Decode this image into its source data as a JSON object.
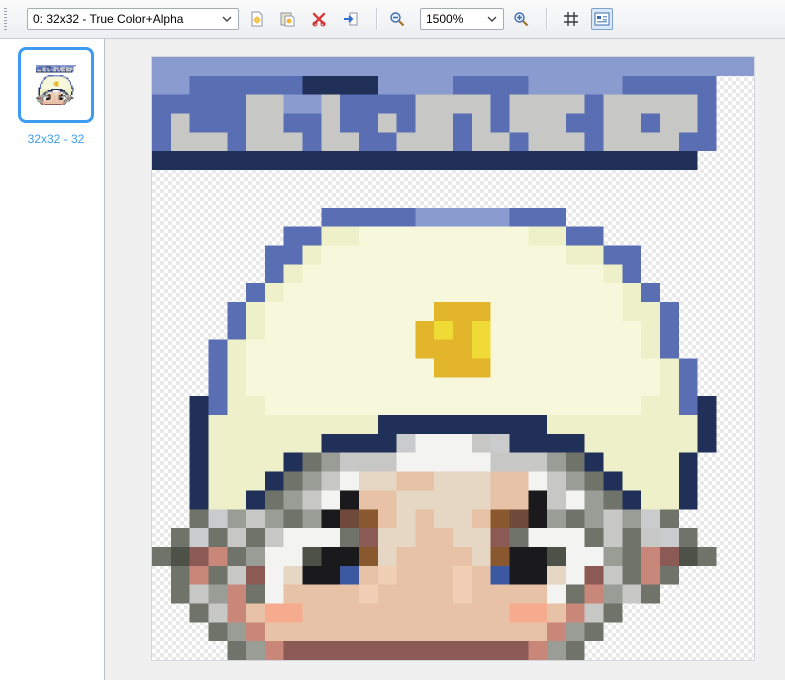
{
  "toolbar": {
    "image_select": "0: 32x32 - True Color+Alpha",
    "zoom_select": "1500%",
    "icons": [
      "new-icon",
      "paste-icon",
      "delete-icon",
      "import-icon",
      "zoom-out-icon",
      "zoom-in-icon",
      "grid-icon",
      "view-icon"
    ]
  },
  "sidebar": {
    "thumbnail_label": "32x32 - 32",
    "selected_border_color": "#3d9cf0"
  },
  "canvas": {
    "palette": {
      "0": "transparent",
      "1": "#203058",
      "2": "#3f549b",
      "3": "#5a6eb4",
      "4": "#8a9bd0",
      "5": "#c9cbcd",
      "6": "#eef0c9",
      "7": "#f7f7dc",
      "8": "#e3b52b",
      "9": "#f0da36",
      "a": "#c7c7c5",
      "b": "#9a9c96",
      "c": "#6f736a",
      "d": "#4d5148",
      "e": "#1a1a1c",
      "f": "#f3f3f1",
      "g": "#e8c2a6",
      "h": "#f0cfb4",
      "i": "#f6ab8f",
      "j": "#c9877a",
      "k": "#6f4a3a",
      "l": "#3b58a0",
      "m": "#89582f",
      "n": "#d3a989",
      "o": "#8b5a54",
      "p": "#a9a9a9",
      "q": "#e6d7c4"
    },
    "rows": [
      "44444444444444444444444444444444",
      "443333331111444433334444433333",
      "33333aa44a3333aaaa3aaaa3aaaaa3",
      "3a333aa33a33a3aa3a3aaa33aa3aa3",
      "3aaa3aaa3aa33aaa3aa3aaa3aaaa33",
      "11111111111111111111111111111",
      "00000000000000000000000000000000",
      "00000000000000000000000000000000",
      "00000000033333444443330000000000",
      "00000003366777777777663300000000",
      "00000033677777777777776633000000",
      "00000036777777777777777763000000",
      "00000367777777777777777776300000",
      "00003677777777788877777776630000",
      "00003677777777898977777777630000",
      "00036777777777888977777777630000",
      "00036777777777788877777777763000",
      "00036777777777777777777777763000",
      "00136677777777777777777777663100",
      "00166666666611111111166666666100",
      "00166666611115fffa5111166666610",
      "00166661cbaaafffffaaabc1666610",
      "0016661cbafqqggqqqggfabc166610",
      "001661cbafeggqqqqqggeafbc16610",
      "00c5babcbekmgqgqqgmkebcbab5c00",
      "0c5cacafffcoqqggqqocfffcaca5c0",
      "cdojcbffdeemqggggqmeedffbcjodc",
      "0cjcaofqeelghggghgleeqfoacjc00",
      "0cabjcfgggghgggghggggfcjbac00",
      "00cajgiigggggggggggiigjac000",
      "000cbjgggggggggggggggjbc0000",
      "0000cbjooooooooooooojbc00000"
    ]
  }
}
